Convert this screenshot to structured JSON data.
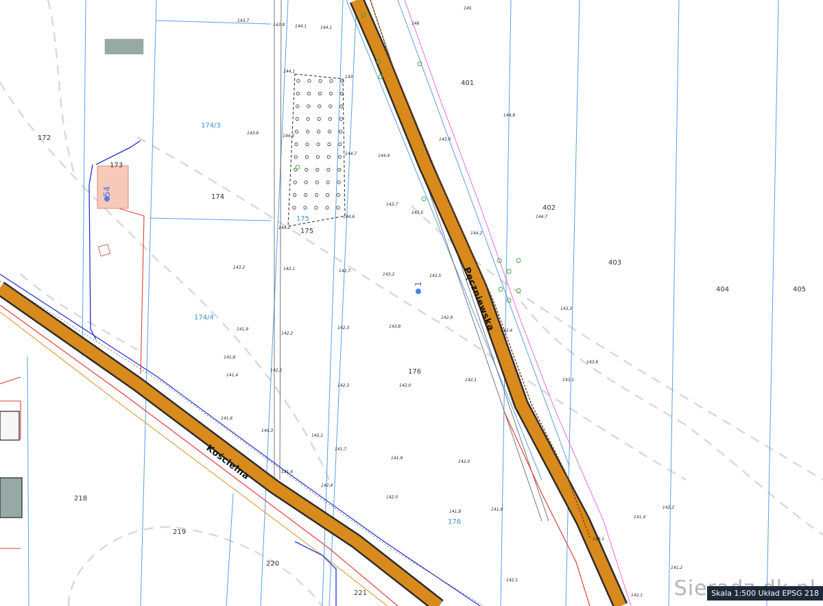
{
  "map": {
    "roads": [
      {
        "name": "Kościelna"
      },
      {
        "name": "Pęczniewska"
      }
    ],
    "parcels": [
      "172",
      "173",
      "174",
      "174/3",
      "174/4",
      "175",
      "175",
      "176",
      "176",
      "401",
      "402",
      "403",
      "404",
      "405",
      "218",
      "219",
      "220",
      "221"
    ],
    "addresses": [
      "54",
      "1"
    ],
    "elevations": [
      "143,7",
      "143,8",
      "144,1",
      "144,1",
      "145",
      "146",
      "144,1",
      "143",
      "143,6",
      "144,0",
      "144,7",
      "144,4",
      "144,8",
      "143,9",
      "144,7",
      "143,7",
      "143,5",
      "144,2",
      "144,6",
      "143,2",
      "142,1",
      "142,7",
      "143,2",
      "143,5",
      "144,2",
      "143,8",
      "142,3",
      "142,9",
      "143,3",
      "142,4",
      "143,6",
      "142,1",
      "143,1",
      "142,0",
      "142,3",
      "141,9",
      "142,2",
      "141,8",
      "141,4",
      "142,2",
      "141,6",
      "140,3",
      "142,1",
      "141,7",
      "141,9",
      "142,0",
      "141,6",
      "141,9",
      "141,8",
      "142,5",
      "142,4",
      "141,4",
      "142,2",
      "143,1",
      "142,1",
      "141,2",
      "142,1"
    ],
    "colors": {
      "road_fill": "#d98a1c",
      "road_edge": "#2b2b2b",
      "cadastre_line": "#4a90d9",
      "building_fill": "#f6c9b8",
      "power_line": "#e23b3b",
      "water_line": "#1f2fd0",
      "gas_line": "#e08a1a",
      "contour": "#d6d6d6"
    }
  },
  "branding": {
    "site_text": "Sieradz.dk.pl"
  },
  "status_bar": {
    "text": "Skala 1:500   Układ EPSG 218"
  }
}
